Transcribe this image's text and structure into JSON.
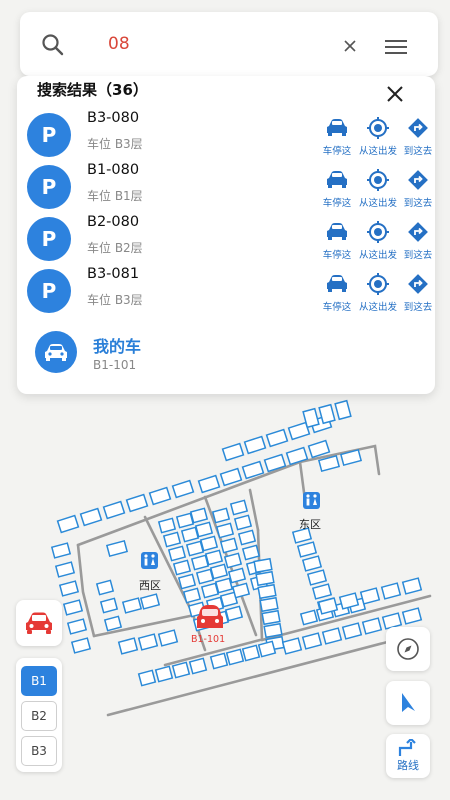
{
  "search": {
    "query": "08"
  },
  "results": {
    "title": "搜索结果（36）",
    "items": [
      {
        "badge": "P",
        "name": "B3-080",
        "sub": "车位 B3层"
      },
      {
        "badge": "P",
        "name": "B1-080",
        "sub": "车位 B1层"
      },
      {
        "badge": "P",
        "name": "B2-080",
        "sub": "车位 B2层"
      },
      {
        "badge": "P",
        "name": "B3-081",
        "sub": "车位 B3层"
      }
    ],
    "actions": [
      "车停这",
      "从这出发",
      "到这去"
    ],
    "my_car": {
      "title": "我的车",
      "sub": "B1-101"
    }
  },
  "map": {
    "zones": {
      "west": "西区",
      "east": "东区"
    },
    "car_marker_label": "B1-101",
    "restroom_icon": "restroom-icon"
  },
  "floors": {
    "items": [
      "B1",
      "B2",
      "B3"
    ],
    "active": "B1"
  },
  "controls": {
    "route_label": "路线"
  },
  "colors": {
    "accent": "#2d82de",
    "space_stroke": "#2b8ad8",
    "road": "#9a9a9a",
    "car_marker": "#e53935",
    "query_text": "#d9473a"
  }
}
